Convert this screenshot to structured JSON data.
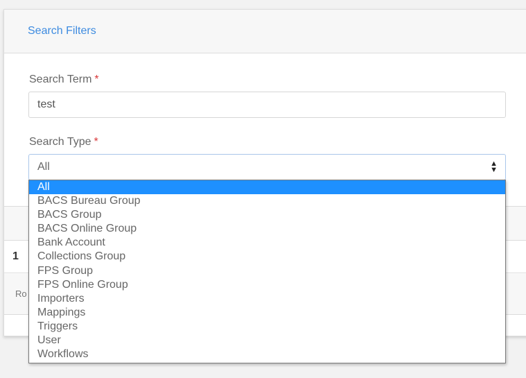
{
  "filters": {
    "title": "Search Filters",
    "search_term": {
      "label": "Search Term",
      "required_mark": "*",
      "value": "test"
    },
    "search_type": {
      "label": "Search Type",
      "required_mark": "*",
      "selected": "All",
      "options": [
        "All",
        "BACS Bureau Group",
        "BACS Group",
        "BACS Online Group",
        "Bank Account",
        "Collections Group",
        "FPS Group",
        "FPS Online Group",
        "Importers",
        "Mappings",
        "Triggers",
        "User",
        "Workflows"
      ]
    }
  },
  "results": {
    "first_row_value": "1",
    "footer_text": "Ro"
  },
  "colors": {
    "accent": "#3d8be0",
    "selected_option_bg": "#1e90ff",
    "required": "#d9383a"
  }
}
